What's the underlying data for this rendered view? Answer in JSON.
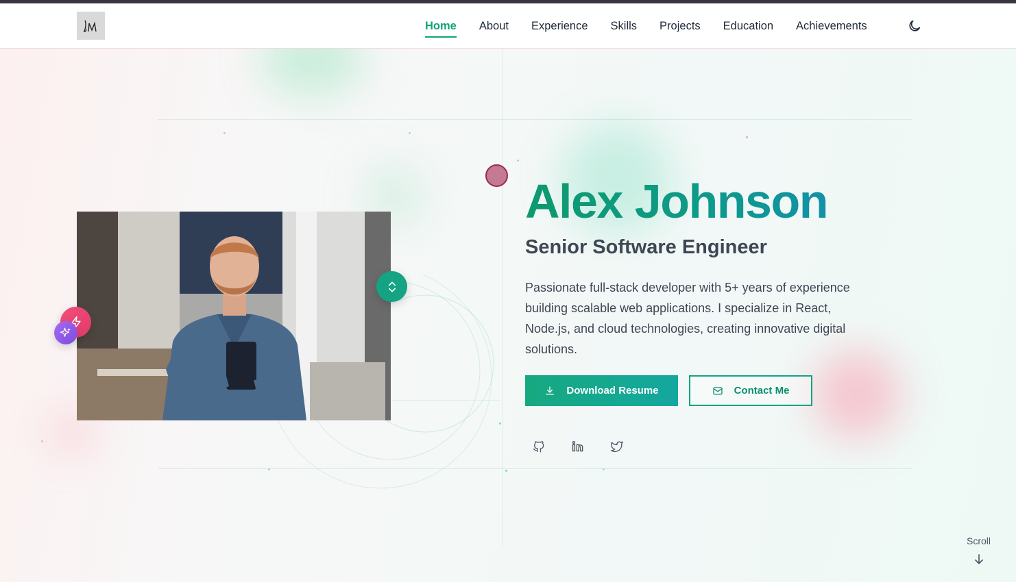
{
  "nav": {
    "logo_text": "JM",
    "links": [
      {
        "label": "Home",
        "active": true
      },
      {
        "label": "About"
      },
      {
        "label": "Experience"
      },
      {
        "label": "Skills"
      },
      {
        "label": "Projects"
      },
      {
        "label": "Education"
      },
      {
        "label": "Achievements"
      }
    ],
    "theme_toggle_icon": "moon-icon"
  },
  "hero": {
    "name": "Alex Johnson",
    "title": "Senior Software Engineer",
    "description": "Passionate full-stack developer with 5+ years of experience building scalable web applications. I specialize in React, Node.js, and cloud technologies, creating innovative digital solutions.",
    "buttons": {
      "primary_label": "Download Resume",
      "primary_icon": "download-icon",
      "secondary_label": "Contact Me",
      "secondary_icon": "mail-icon"
    },
    "social": [
      "github-icon",
      "linkedin-icon",
      "twitter-icon"
    ],
    "photo_alt": "profile-photo"
  },
  "scroll": {
    "label": "Scroll",
    "icon": "arrow-down-icon"
  },
  "colors": {
    "accent": "#10a47a",
    "accent_teal": "#14a383",
    "pink": "#e23a6a",
    "purple": "#7c4ce0"
  }
}
